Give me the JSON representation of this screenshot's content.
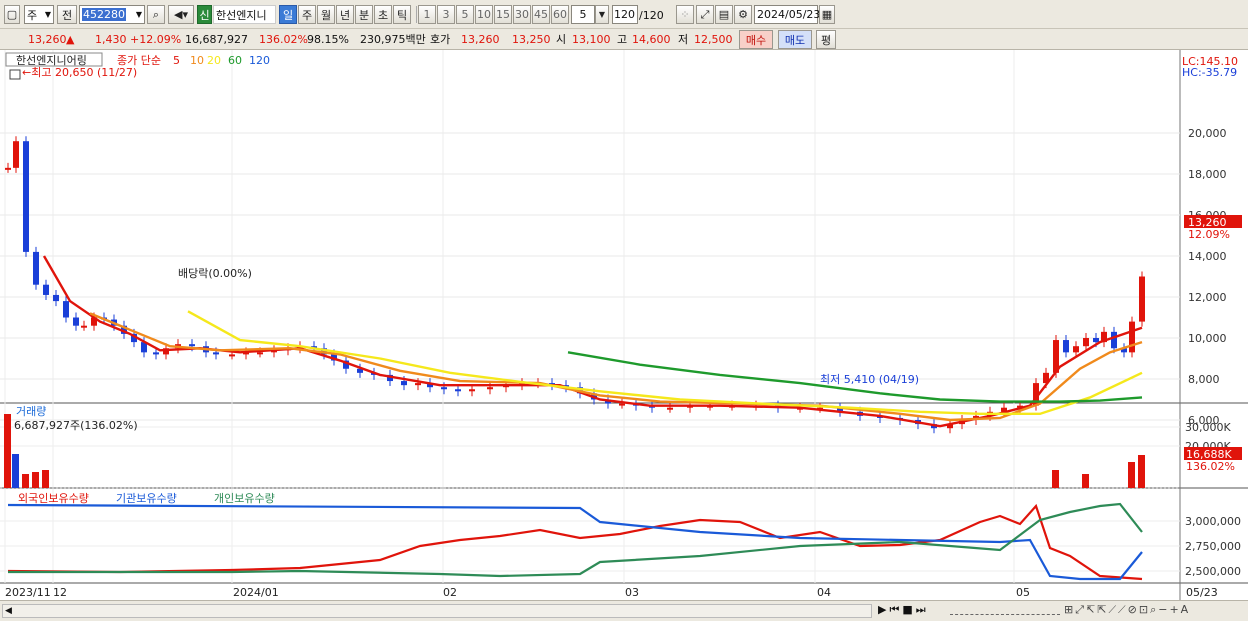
{
  "toolbar": {
    "market": "주",
    "period_type": "전",
    "code": "452280",
    "name": "한선엔지니",
    "badge": "신",
    "periods": [
      "일",
      "주",
      "월",
      "년",
      "분",
      "초",
      "틱"
    ],
    "intervals": [
      "1",
      "3",
      "5",
      "10",
      "15",
      "30",
      "45",
      "60"
    ],
    "custom_interval": "5",
    "count": "120",
    "count_total": "/120",
    "date": "2024/05/23"
  },
  "quote": {
    "price": "13,260",
    "arrow": "▲",
    "change": "1,430",
    "change_pct": "+12.09%",
    "volume": "16,687,927",
    "vol_ratio": "136.02%",
    "strength": "98.15%",
    "amount": "230,975백만",
    "hoga_label": "호가",
    "ask": "13,260",
    "bid": "13,250",
    "open_label": "시",
    "open": "13,100",
    "high_label": "고",
    "high": "14,600",
    "low_label": "저",
    "low": "12,500",
    "buy_label": "매수",
    "sell_label": "매도",
    "eval_label": "평"
  },
  "price_panel": {
    "name": "한선엔지니어링",
    "ma_label": "종가 단순",
    "ma_periods": [
      "5",
      "10",
      "20",
      "60",
      "120"
    ],
    "ma_colors": [
      "#e0140b",
      "#f08a1c",
      "#f5e81c",
      "#1e9a2c",
      "#1a5ad8"
    ],
    "max_note": "최고 20,650 (11/27)",
    "min_note": "최저 5,410 (04/19)",
    "div_note": "배당락(0.00%)",
    "lc": "LC:145.10",
    "hc": "HC:-35.79",
    "axis": [
      "20,000",
      "18,000",
      "16,000",
      "14,000",
      "12,000",
      "10,000",
      "8,000",
      "6,000"
    ],
    "last_price": "13,260",
    "last_pct": "12.09%"
  },
  "volume_panel": {
    "title": "거래량",
    "value_note": "6,687,927주(136.02%)",
    "axis": [
      "30,000K",
      "20,000K"
    ],
    "last": "16,688K",
    "last_pct": "136.02%"
  },
  "holding_panel": {
    "labels": [
      "외국인보유수량",
      "기관보유수량",
      "개인보유수량"
    ],
    "colors": [
      "#e0140b",
      "#1a5ad8",
      "#2e8b57"
    ],
    "axis": [
      "3,000,000",
      "2,750,000",
      "2,500,000"
    ]
  },
  "date_axis": [
    "2023/11",
    "12",
    "2024/01",
    "02",
    "03",
    "04",
    "05",
    "05/23"
  ]
}
